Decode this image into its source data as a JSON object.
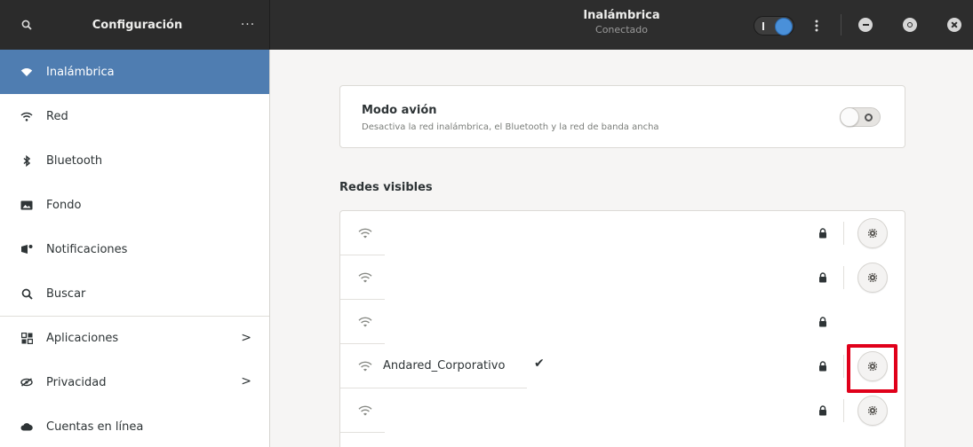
{
  "header": {
    "left_title": "Configuración",
    "panel_title": "Inalámbrica",
    "panel_subtitle": "Conectado",
    "menu_label": "···"
  },
  "sidebar": {
    "items": [
      {
        "label": "Inalámbrica",
        "icon": "wifi-icon",
        "active": true
      },
      {
        "label": "Red",
        "icon": "network-icon"
      },
      {
        "label": "Bluetooth",
        "icon": "bluetooth-icon"
      },
      {
        "label": "Fondo",
        "icon": "background-icon"
      },
      {
        "label": "Notificaciones",
        "icon": "notifications-icon"
      },
      {
        "label": "Buscar",
        "icon": "search-icon"
      },
      {
        "label": "Aplicaciones",
        "icon": "apps-grid-icon",
        "chevron": ">"
      },
      {
        "label": "Privacidad",
        "icon": "privacy-icon",
        "chevron": ">"
      },
      {
        "label": "Cuentas en línea",
        "icon": "online-accounts-icon"
      }
    ]
  },
  "airplane": {
    "title": "Modo avión",
    "description": "Desactiva la red inalámbrica, el Bluetooth y la red de banda ancha",
    "enabled": false
  },
  "wifi_enabled": true,
  "networks": {
    "section_title": "Redes visibles",
    "rows": [
      {
        "name": "",
        "secured": true,
        "settings": true
      },
      {
        "name": "",
        "secured": true,
        "settings": true
      },
      {
        "name": "",
        "secured": true,
        "settings": false
      },
      {
        "name": "Andared_Corporativo",
        "connected_mark": "✔",
        "secured": true,
        "settings": true,
        "highlighted": true
      },
      {
        "name": "",
        "secured": true,
        "settings": true
      }
    ]
  },
  "colors": {
    "header_bg": "#2d2d2d",
    "accent": "#4a90d9",
    "selection": "#4f7db1",
    "highlight_box": "#e0001a"
  }
}
